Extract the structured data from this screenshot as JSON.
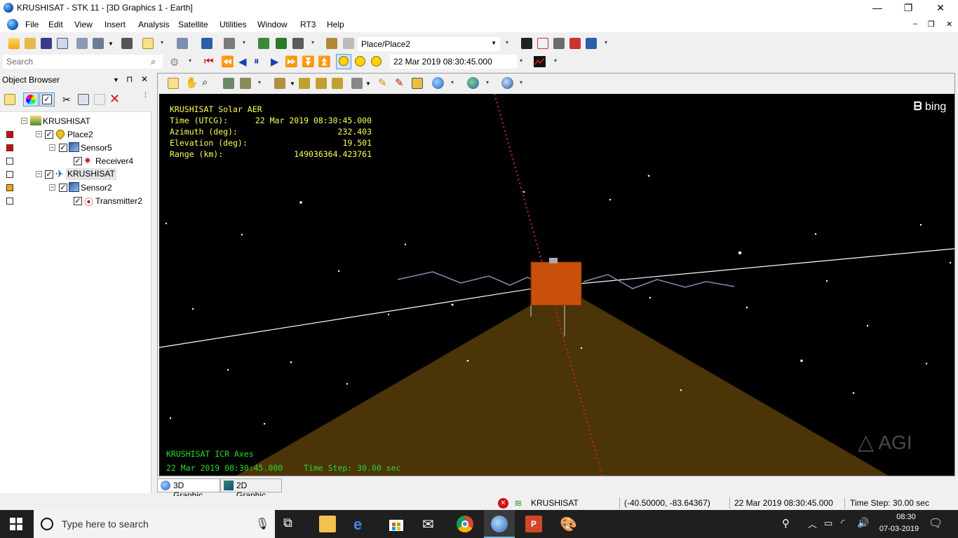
{
  "window": {
    "title": "KRUSHISAT - STK 11 - [3D Graphics 1 - Earth]",
    "minimize": "—",
    "restore": "❐",
    "close": "✕"
  },
  "menubar": {
    "items": [
      "File",
      "Edit",
      "View",
      "Insert",
      "Analysis",
      "Satellite",
      "Utilities",
      "Window",
      "RT3",
      "Help"
    ],
    "mdi_min": "–",
    "mdi_restore": "❐",
    "mdi_close": "✕"
  },
  "toolbar": {
    "object_combo": "Place/Place2",
    "search_placeholder": "Search",
    "time_value": "22 Mar 2019 08:30:45.000"
  },
  "object_browser": {
    "title": "Object Browser",
    "pin": "⊓",
    "close": "✕",
    "tree": [
      {
        "label": "KRUSHISAT",
        "icon": "scenario-icon",
        "color": "",
        "checked": false
      },
      {
        "label": "Place2",
        "icon": "place-icon",
        "color": "#e00000",
        "checked": true
      },
      {
        "label": "Sensor5",
        "icon": "sensor-icon",
        "color": "#e00000",
        "checked": true
      },
      {
        "label": "Receiver4",
        "icon": "receiver-icon",
        "color": "#ffffff",
        "checked": true
      },
      {
        "label": "KRUSHISAT",
        "icon": "satellite-icon",
        "color": "#ffffff",
        "checked": true
      },
      {
        "label": "Sensor2",
        "icon": "sensor-icon",
        "color": "#f0a800",
        "checked": true
      },
      {
        "label": "Transmitter2",
        "icon": "transmitter-icon",
        "color": "#ffffff",
        "checked": true
      }
    ]
  },
  "scene": {
    "hud_title": "KRUSHISAT Solar AER",
    "hud_rows": [
      {
        "label": "Time (UTCG):",
        "value": "22 Mar 2019 08:30:45.000"
      },
      {
        "label": "Azimuth (deg):",
        "value": "232.403"
      },
      {
        "label": "Elevation (deg):",
        "value": "19.501"
      },
      {
        "label": "Range (km):",
        "value": "149036364.423761"
      }
    ],
    "axes_label": "KRUSHISAT ICR Axes",
    "bottom_time": "22 Mar 2019 08:30:45.000",
    "time_step": "Time Step: 30.00 sec",
    "bing": "bing",
    "agi": "AGI"
  },
  "tabs": [
    "3D Graphic...",
    "2D Graphic..."
  ],
  "statusbar": {
    "object": "KRUSHISAT",
    "coords": "(-40.50000, -83.64367)",
    "time": "22 Mar 2019 08:30:45.000",
    "step": "Time Step: 30.00 sec"
  },
  "taskbar": {
    "search_placeholder": "Type here to search",
    "clock_time": "08:30",
    "clock_date": "07-03-2019"
  }
}
